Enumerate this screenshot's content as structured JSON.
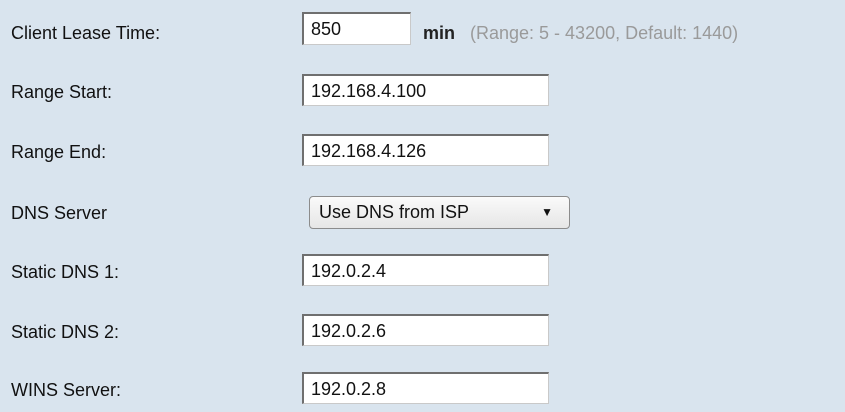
{
  "lease": {
    "label": "Client Lease Time:",
    "value": "850",
    "unit": "min",
    "hint": "(Range: 5 - 43200, Default: 1440)"
  },
  "range_start": {
    "label": "Range Start:",
    "value": "192.168.4.100"
  },
  "range_end": {
    "label": "Range End:",
    "value": "192.168.4.126"
  },
  "dns_server": {
    "label": "DNS Server",
    "selected": "Use DNS from ISP",
    "caret_icon": "▼"
  },
  "static_dns1": {
    "label": "Static DNS 1:",
    "value": "192.0.2.4"
  },
  "static_dns2": {
    "label": "Static DNS 2:",
    "value": "192.0.2.6"
  },
  "wins_server": {
    "label": "WINS Server:",
    "value": "192.0.2.8"
  }
}
